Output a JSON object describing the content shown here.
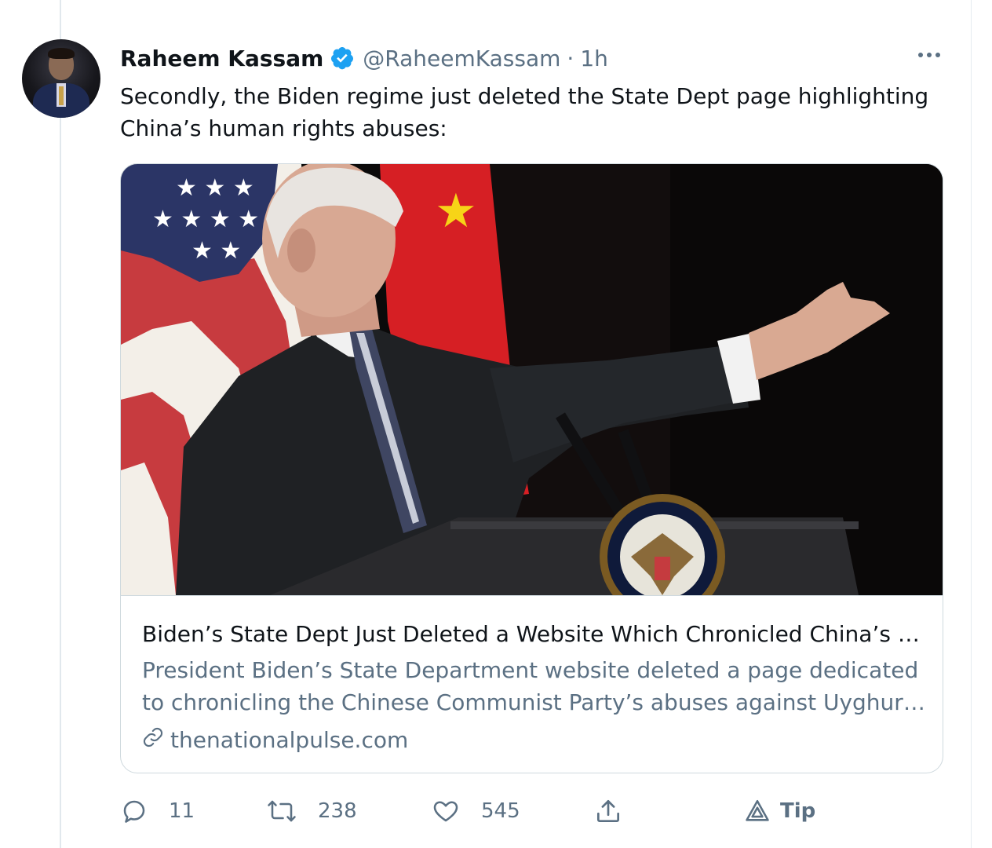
{
  "author": {
    "name": "Raheem Kassam",
    "handle": "@RaheemKassam",
    "separator": "·",
    "time": "1h"
  },
  "tweet": {
    "text": "Secondly, the Biden regime just deleted the State Dept page highlighting China’s human rights abuses:"
  },
  "card": {
    "title": "Biden’s State Dept Just Deleted a Website Which Chronicled China’s G...",
    "description": "President Biden’s State Department website deleted a page dedicated to chronicling the Chinese Communist Party’s abuses against Uyghurs. Th...",
    "domain": "thenationalpulse.com"
  },
  "actions": {
    "reply_count": "11",
    "retweet_count": "238",
    "like_count": "545",
    "tip_label": "Tip"
  },
  "colors": {
    "verified": "#1da1f2",
    "secondary_text": "#5b7083",
    "border": "#cfd9de"
  }
}
